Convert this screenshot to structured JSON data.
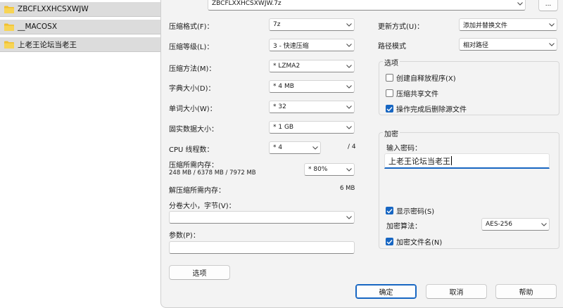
{
  "explorer": {
    "folders": [
      {
        "name": "ZBCFLXXHCSXWJW"
      },
      {
        "name": "__MACOSX"
      },
      {
        "name": "上老王论坛当老王"
      }
    ],
    "folder_color": "#f0c030"
  },
  "archive": {
    "path_value": "ZBCFLXXHCSXWJW.7z",
    "browse_label": "..."
  },
  "left": {
    "format_label": "压缩格式(F)：",
    "format_value": "7z",
    "level_label": "压缩等级(L)：",
    "level_value": "3 - 快速压缩",
    "method_label": "压缩方法(M)：",
    "method_value": "* LZMA2",
    "dict_label": "字典大小(D)：",
    "dict_value": "* 4 MB",
    "word_label": "单词大小(W)：",
    "word_value": "* 32",
    "solid_label": "固实数据大小：",
    "solid_value": "* 1 GB",
    "threads_label": "CPU 线程数：",
    "threads_value": "* 4",
    "threads_total": "/ 4",
    "mem_label": "压缩所需内存：",
    "mem_detail": "248 MB / 6378 MB / 7972 MB",
    "mem_value": "* 80%",
    "decomp_label": "解压缩所需内存：",
    "decomp_value": "6 MB",
    "split_label": "分卷大小，字节(V)：",
    "split_value": "",
    "params_label": "参数(P)：",
    "params_value": "",
    "options_button": "选项"
  },
  "right": {
    "update_label": "更新方式(U)：",
    "update_value": "添加并替换文件",
    "pathmode_label": "路径模式",
    "pathmode_value": "相对路径",
    "options_title": "选项",
    "opt_sfx": "创建自释放程序(X)",
    "opt_sfx_checked": false,
    "opt_shared": "压缩共享文件",
    "opt_shared_checked": false,
    "opt_delete": "操作完成后删除源文件",
    "opt_delete_checked": true,
    "encryption_title": "加密",
    "password_label": "输入密码：",
    "password_value": "上老王论坛当老王",
    "show_password": "显示密码(S)",
    "show_password_checked": true,
    "enc_method_label": "加密算法：",
    "enc_method_value": "AES-256",
    "encrypt_names": "加密文件名(N)",
    "encrypt_names_checked": true
  },
  "buttons": {
    "ok": "确定",
    "cancel": "取消",
    "help": "帮助"
  },
  "colors": {
    "accent": "#1766c2",
    "dialog_bg": "#f3f3f3"
  }
}
